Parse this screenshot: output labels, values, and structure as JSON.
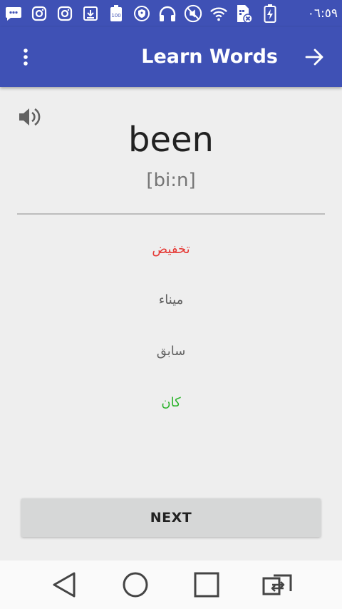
{
  "status_bar": {
    "time": "٠٦:٥٩",
    "icons": [
      "sms-icon",
      "instagram-icon",
      "instagram-icon",
      "download-icon",
      "battery-100-icon",
      "vpn-shield-icon",
      "headphones-icon",
      "mute-icon",
      "wifi-icon",
      "sim-no-signal-icon",
      "battery-charging-icon"
    ]
  },
  "app_bar": {
    "title": "Learn Words",
    "menu_icon": "more-vert-icon",
    "forward_icon": "arrow-forward-icon"
  },
  "card": {
    "word": "been",
    "phonetic": "[bi:n]",
    "speaker_icon": "volume-up-icon"
  },
  "options": [
    {
      "text": "تخفيض",
      "color": "#e53935"
    },
    {
      "text": "ميناء",
      "color": "#616161"
    },
    {
      "text": "سابق",
      "color": "#616161"
    },
    {
      "text": "كان",
      "color": "#2bb32b"
    }
  ],
  "next_label": "NEXT",
  "nav": {
    "back": "back-triangle-icon",
    "home": "home-circle-icon",
    "recents": "recents-square-icon",
    "switch": "switch-app-icon"
  },
  "colors": {
    "primary": "#3f51b5",
    "background": "#eeeeee"
  }
}
